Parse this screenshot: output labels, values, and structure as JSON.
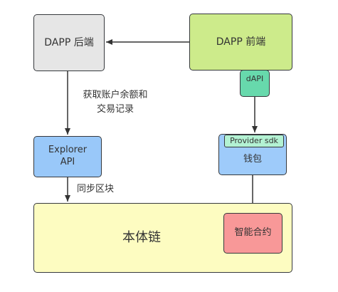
{
  "nodes": {
    "backend": "DAPP 后端",
    "frontend": "DAPP 前端",
    "dapi": "dAPI",
    "explorer_line1": "Explorer",
    "explorer_line2": "API",
    "wallet": "钱包",
    "provider": "Provider sdk",
    "chain": "本体链",
    "contract": "智能合约"
  },
  "edges": {
    "backend_to_explorer_line1": "获取账户余额和",
    "backend_to_explorer_line2": "交易记录",
    "explorer_to_chain": "同步区块"
  },
  "colors": {
    "backend": "#e6e6e6",
    "frontend": "#cdeb8b",
    "dapi": "#67d9ac",
    "explorer": "#99c8f9",
    "wallet": "#9ecbfa",
    "provider": "#b3f2d3",
    "chain": "#fdfcc1",
    "contract": "#f89898"
  }
}
